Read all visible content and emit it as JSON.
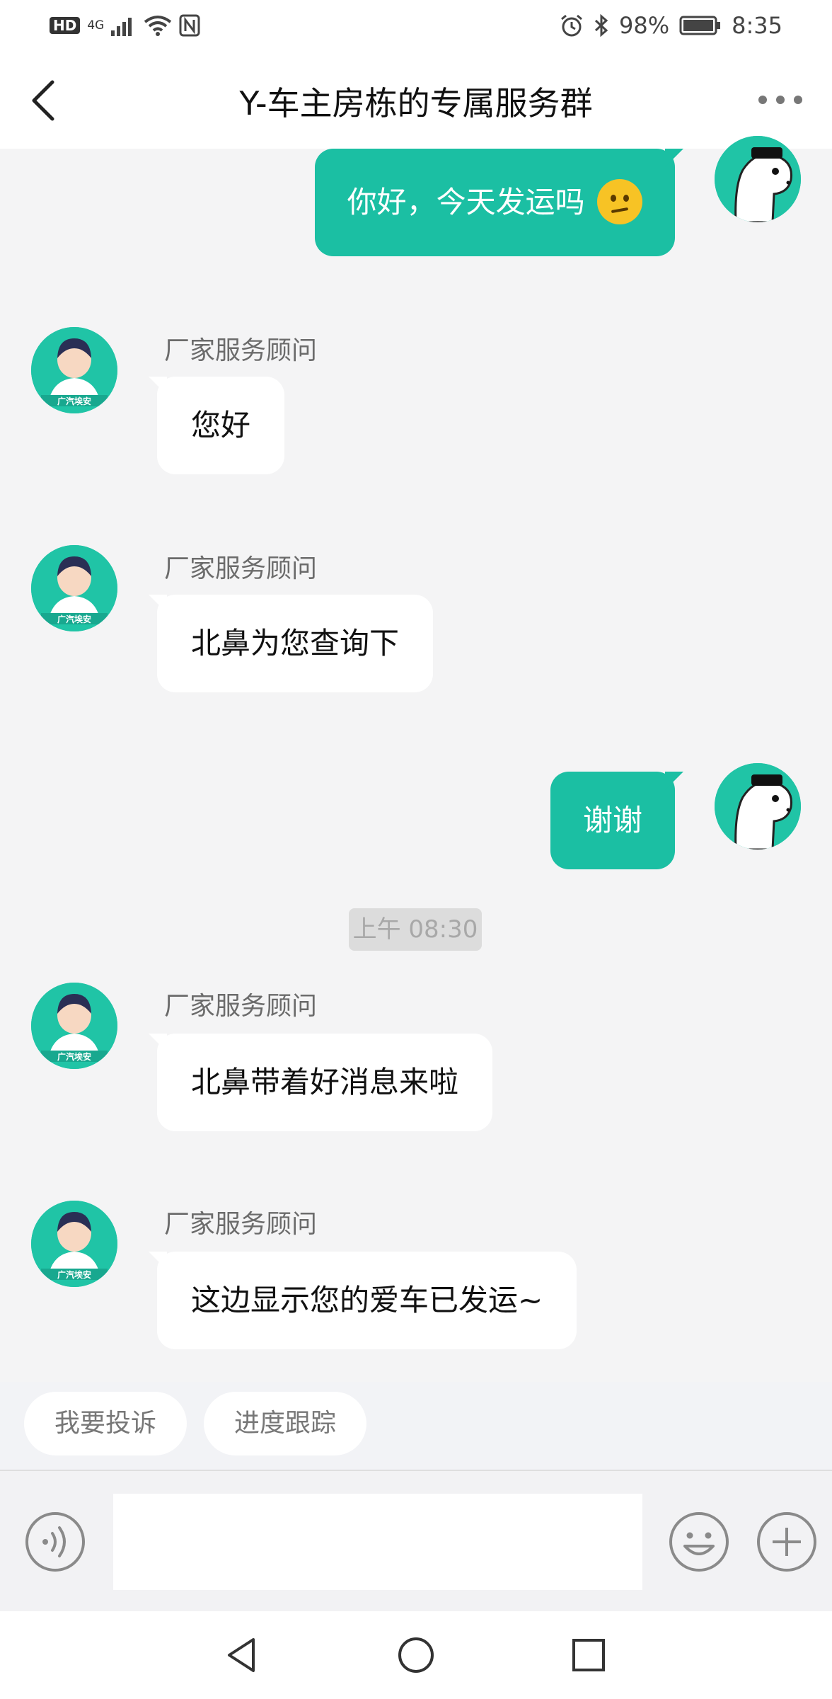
{
  "status_bar": {
    "left_badges": [
      "HD",
      "4G"
    ],
    "battery": "98%",
    "time": "8:35"
  },
  "header": {
    "title": "Y-车主房栋的专属服务群"
  },
  "messages": [
    {
      "direction": "out",
      "text": "你好，今天发运吗"
    },
    {
      "direction": "in",
      "sender": "厂家服务顾问",
      "text": "您好"
    },
    {
      "direction": "in",
      "sender": "厂家服务顾问",
      "text": "北鼻为您查询下"
    },
    {
      "direction": "out",
      "text": "谢谢"
    },
    {
      "direction": "in",
      "sender": "厂家服务顾问",
      "text": "北鼻带着好消息来啦"
    },
    {
      "direction": "in",
      "sender": "厂家服务顾问",
      "text": "这边显示您的爱车已发运~"
    }
  ],
  "timestamp": "上午 08:30",
  "agent_avatar_caption": "广汽埃安",
  "quick_replies": [
    "我要投诉",
    "进度跟踪"
  ],
  "input": {
    "value": "",
    "placeholder": ""
  },
  "icons": {
    "back": "chevron-left-icon",
    "more": "more-dots-icon",
    "voice": "voice-icon",
    "emoji": "emoji-icon",
    "plus": "plus-icon",
    "nav_back": "triangle-back-icon",
    "nav_home": "circle-home-icon",
    "nav_recents": "square-recents-icon"
  },
  "colors": {
    "accent": "#1bbfa3",
    "background": "#f4f4f5",
    "bubble_in": "#ffffff"
  }
}
